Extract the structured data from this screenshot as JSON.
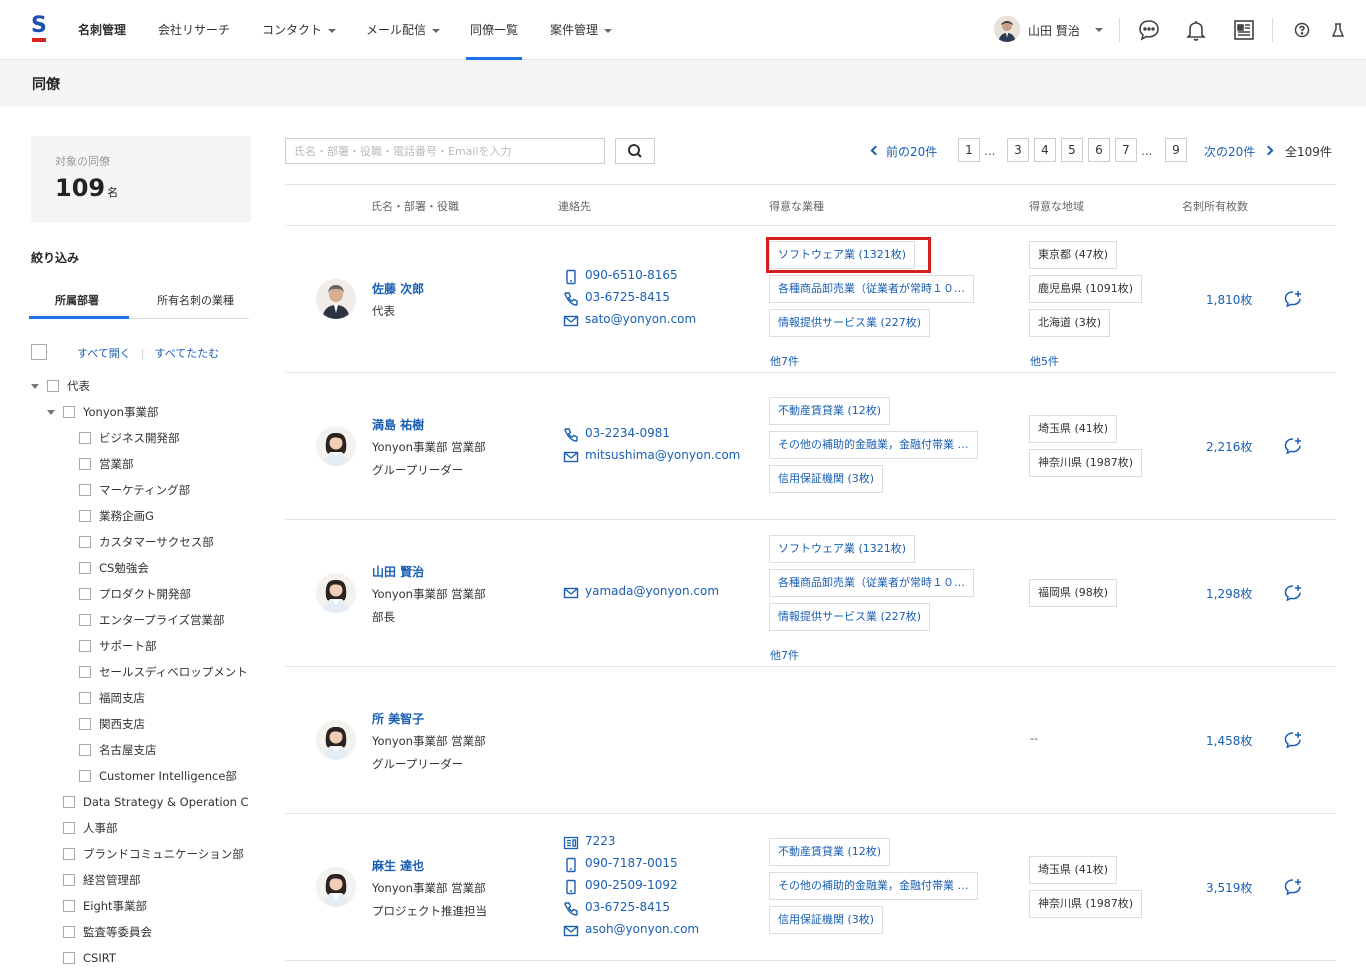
{
  "nav": {
    "logo": "S",
    "items": [
      {
        "label": "名刺管理",
        "caret": false
      },
      {
        "label": "会社リサーチ",
        "caret": false
      },
      {
        "label": "コンタクト",
        "caret": true
      },
      {
        "label": "メール配信",
        "caret": true
      },
      {
        "label": "同僚一覧",
        "caret": false
      },
      {
        "label": "案件管理",
        "caret": true
      }
    ],
    "user_name": "山田 賢治"
  },
  "page_title": "同僚",
  "sidebar": {
    "count_label": "対象の同僚",
    "count_value": "109",
    "count_unit": "名",
    "filter_title": "絞り込み",
    "tabs": [
      "所属部署",
      "所有名刺の業種"
    ],
    "expand_all": "すべて開く",
    "collapse_all": "すべてたたむ",
    "tree": [
      {
        "label": "代表",
        "level": 0,
        "expanded": true
      },
      {
        "label": "Yonyon事業部",
        "level": 1,
        "expanded": true
      },
      {
        "label": "ビジネス開発部",
        "level": 2
      },
      {
        "label": "営業部",
        "level": 2
      },
      {
        "label": "マーケティング部",
        "level": 2
      },
      {
        "label": "業務企画G",
        "level": 2
      },
      {
        "label": "カスタマーサクセス部",
        "level": 2
      },
      {
        "label": "CS勉強会",
        "level": 2
      },
      {
        "label": "プロダクト開発部",
        "level": 2
      },
      {
        "label": "エンタープライズ営業部",
        "level": 2
      },
      {
        "label": "サポート部",
        "level": 2
      },
      {
        "label": "セールスディベロップメント",
        "level": 2
      },
      {
        "label": "福岡支店",
        "level": 2
      },
      {
        "label": "関西支店",
        "level": 2
      },
      {
        "label": "名古屋支店",
        "level": 2
      },
      {
        "label": "Customer Intelligence部",
        "level": 2
      },
      {
        "label": "Data Strategy & Operation C",
        "level": 1
      },
      {
        "label": "人事部",
        "level": 1
      },
      {
        "label": "ブランドコミュニケーション部",
        "level": 1
      },
      {
        "label": "経営管理部",
        "level": 1
      },
      {
        "label": "Eight事業部",
        "level": 1
      },
      {
        "label": "監査等委員会",
        "level": 1
      },
      {
        "label": "CSIRT",
        "level": 1
      }
    ]
  },
  "search": {
    "placeholder": "氏名・部署・役職・電話番号・Emailを入力",
    "value": ""
  },
  "pager": {
    "prev": "前の20件",
    "next": "次の20件",
    "total": "全109件",
    "pages": [
      "1",
      "...",
      "3",
      "4",
      "5",
      "6",
      "7",
      "...",
      "9"
    ]
  },
  "table": {
    "headers": [
      "氏名・部署・役職",
      "連絡先",
      "得意な業種",
      "得意な地域",
      "名刺所有枚数"
    ],
    "rows": [
      {
        "name": "佐藤 次郎",
        "dept": "",
        "title": "代表",
        "contacts": [
          {
            "type": "mobile",
            "value": "090-6510-8165"
          },
          {
            "type": "phone",
            "value": "03-6725-8415"
          },
          {
            "type": "email",
            "value": "sato@yonyon.com"
          }
        ],
        "industries": [
          "ソフトウェア業 (1321枚)",
          "各種商品卸売業（従業者が常時１０…",
          "情報提供サービス業 (227枚)"
        ],
        "industries_more": "他7件",
        "regions": [
          "東京都 (47枚)",
          "鹿児島県 (1091枚)",
          "北海道 (3枚)"
        ],
        "regions_more": "他5件",
        "cards": "1,810枚"
      },
      {
        "name": "満島 祐樹",
        "dept": "Yonyon事業部 営業部",
        "title": "グループリーダー",
        "contacts": [
          {
            "type": "phone",
            "value": "03-2234-0981"
          },
          {
            "type": "email",
            "value": "mitsushima@yonyon.com"
          }
        ],
        "industries": [
          "不動産賃貸業 (12枚)",
          "その他の補助的金融業，金融付帯業 …",
          "信用保証機関 (3枚)"
        ],
        "industries_more": "",
        "regions": [
          "埼玉県 (41枚)",
          "神奈川県 (1987枚)"
        ],
        "regions_more": "",
        "cards": "2,216枚"
      },
      {
        "name": "山田 賢治",
        "dept": "Yonyon事業部 営業部",
        "title": "部長",
        "contacts": [
          {
            "type": "email",
            "value": "yamada@yonyon.com"
          }
        ],
        "industries": [
          "ソフトウェア業 (1321枚)",
          "各種商品卸売業（従業者が常時１０…",
          "情報提供サービス業 (227枚)"
        ],
        "industries_more": "他7件",
        "regions": [
          "福岡県 (98枚)"
        ],
        "regions_more": "",
        "cards": "1,298枚"
      },
      {
        "name": "所 美智子",
        "dept": "Yonyon事業部 営業部",
        "title": "グループリーダー",
        "contacts": [],
        "industries": [],
        "industries_more": "",
        "regions": [],
        "regions_empty": "--",
        "regions_more": "",
        "cards": "1,458枚"
      },
      {
        "name": "麻生 達也",
        "dept": "Yonyon事業部 営業部",
        "title": "プロジェクト推進担当",
        "contacts": [
          {
            "type": "extension",
            "value": "7223"
          },
          {
            "type": "mobile",
            "value": "090-7187-0015"
          },
          {
            "type": "mobile",
            "value": "090-2509-1092"
          },
          {
            "type": "phone",
            "value": "03-6725-8415"
          },
          {
            "type": "email",
            "value": "asoh@yonyon.com"
          }
        ],
        "industries": [
          "不動産賃貸業 (12枚)",
          "その他の補助的金融業，金融付帯業 …",
          "信用保証機関 (3枚)"
        ],
        "industries_more": "",
        "regions": [
          "埼玉県 (41枚)",
          "神奈川県 (1987枚)"
        ],
        "regions_more": "",
        "cards": "3,519枚"
      }
    ]
  },
  "colors": {
    "accent": "#1a73e8",
    "link": "#1a5fb4",
    "highlight": "#d31f1f"
  }
}
